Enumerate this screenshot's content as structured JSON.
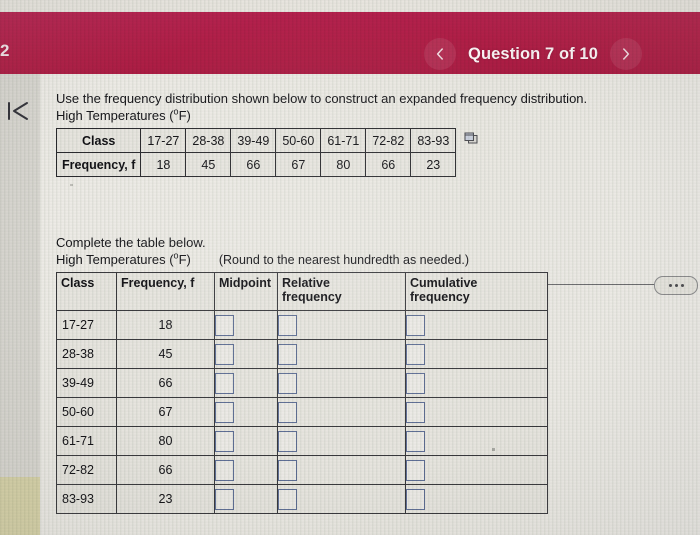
{
  "header": {
    "corner_label": "2",
    "prev_icon": "chevron-left-icon",
    "next_icon": "chevron-right-icon",
    "title": "Question 7 of 10",
    "bar_color": "#b01e46"
  },
  "sidebar": {
    "collapse_icon": "collapse-to-start-icon"
  },
  "question": {
    "prompt": "Use the frequency distribution shown below to construct an expanded frequency distribution.",
    "table_caption_prefix": "High Temperatures (",
    "degree": "o",
    "table_caption_suffix": "F)",
    "popout_icon": "popout-window-icon"
  },
  "given_table": {
    "row_headers": [
      "Class",
      "Frequency, f"
    ],
    "classes": [
      "17-27",
      "28-38",
      "39-49",
      "50-60",
      "61-71",
      "72-82",
      "83-93"
    ],
    "frequencies": [
      "18",
      "45",
      "66",
      "67",
      "80",
      "66",
      "23"
    ]
  },
  "divider": {
    "more_icon": "ellipsis-more-icon"
  },
  "answer_section": {
    "instruction": "Complete the table below.",
    "caption_prefix": "High Temperatures (",
    "degree": "o",
    "caption_suffix": "F)",
    "rounding_hint": "(Round to the nearest hundredth as needed.)",
    "columns": [
      "Class",
      "Frequency, f",
      "Midpoint",
      "Relative frequency",
      "Cumulative frequency"
    ],
    "column_line1": [
      "Class",
      "Frequency, f",
      "Midpoint",
      "Relative",
      "Cumulative"
    ],
    "column_line2": [
      "",
      "",
      "",
      "frequency",
      "frequency"
    ],
    "rows": [
      {
        "class": "17-27",
        "frequency": "18",
        "midpoint": "",
        "relative_frequency": "",
        "cumulative_frequency": ""
      },
      {
        "class": "28-38",
        "frequency": "45",
        "midpoint": "",
        "relative_frequency": "",
        "cumulative_frequency": ""
      },
      {
        "class": "39-49",
        "frequency": "66",
        "midpoint": "",
        "relative_frequency": "",
        "cumulative_frequency": ""
      },
      {
        "class": "50-60",
        "frequency": "67",
        "midpoint": "",
        "relative_frequency": "",
        "cumulative_frequency": ""
      },
      {
        "class": "61-71",
        "frequency": "80",
        "midpoint": "",
        "relative_frequency": "",
        "cumulative_frequency": ""
      },
      {
        "class": "72-82",
        "frequency": "66",
        "midpoint": "",
        "relative_frequency": "",
        "cumulative_frequency": ""
      },
      {
        "class": "83-93",
        "frequency": "23",
        "midpoint": "",
        "relative_frequency": "",
        "cumulative_frequency": ""
      }
    ]
  }
}
